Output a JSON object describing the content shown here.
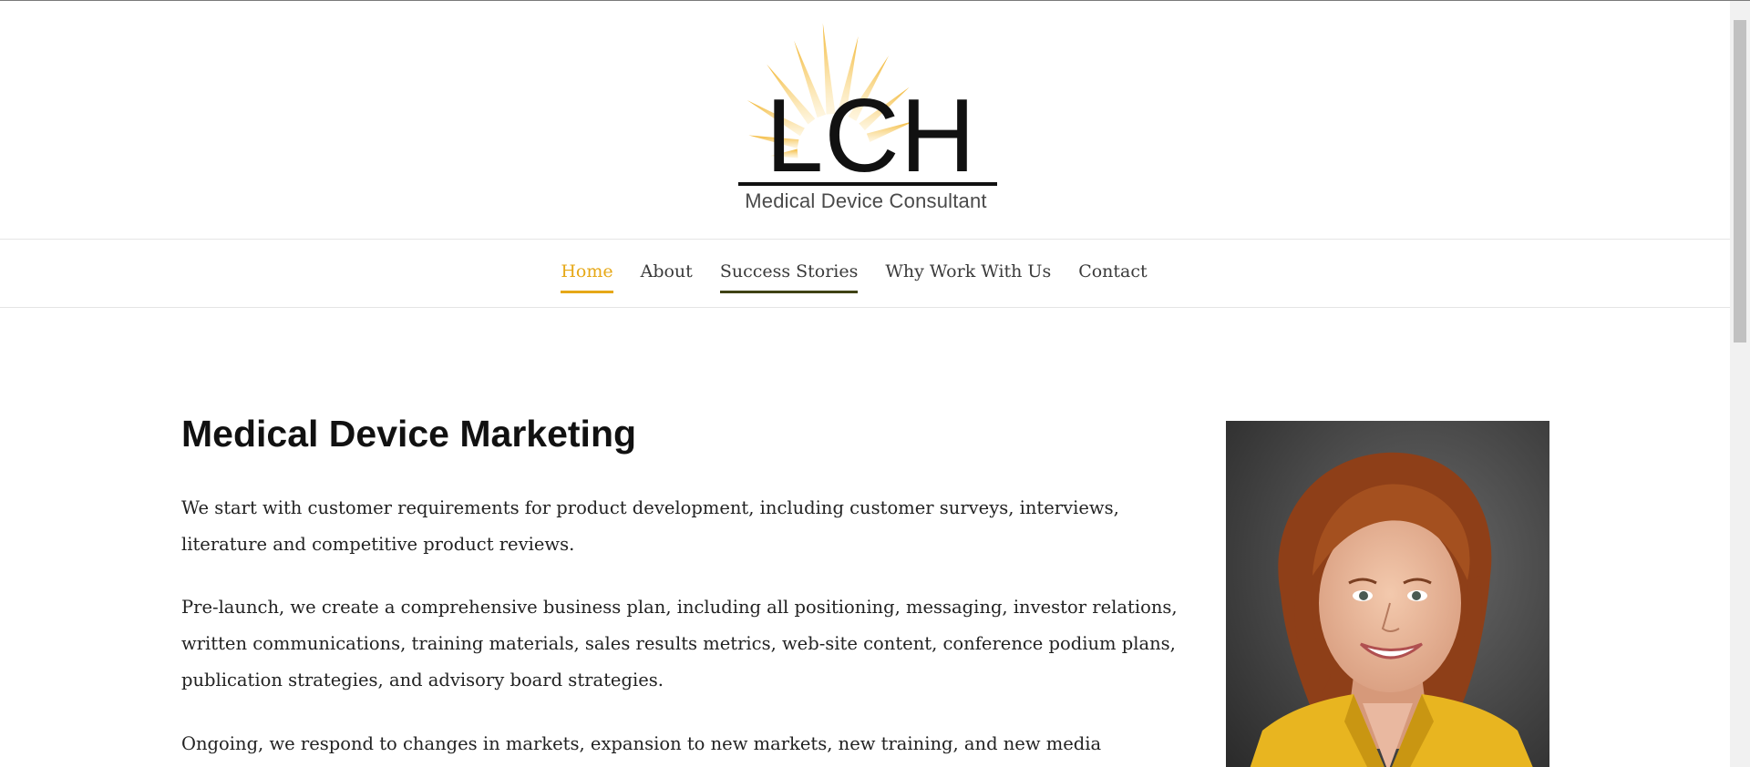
{
  "logo": {
    "letters": "LCH",
    "tagline": "Medical Device Consultant",
    "accent_color": "#f2b632"
  },
  "nav": {
    "items": [
      {
        "label": "Home",
        "state": "active"
      },
      {
        "label": "About",
        "state": "normal"
      },
      {
        "label": "Success Stories",
        "state": "hover"
      },
      {
        "label": "Why Work With Us",
        "state": "normal"
      },
      {
        "label": "Contact",
        "state": "normal"
      }
    ],
    "active_color": "#e6a817",
    "hover_underline_color": "#3f4214"
  },
  "main": {
    "title": "Medical Device Marketing",
    "paragraphs": [
      "We start with customer requirements for product development, including customer surveys, interviews, literature and competitive product reviews.",
      "Pre-launch, we create a comprehensive business plan, including all positioning, messaging, investor relations, written communications, training materials, sales results metrics, web-site content, conference podium plans, publication strategies, and advisory board strategies.",
      "Ongoing, we respond to changes in markets, expansion to new markets, new training, and new media opportunities to keep"
    ]
  },
  "portrait": {
    "icon": "portrait-photo",
    "jacket_color": "#e8b520",
    "hair_color": "#9a4a1f"
  }
}
